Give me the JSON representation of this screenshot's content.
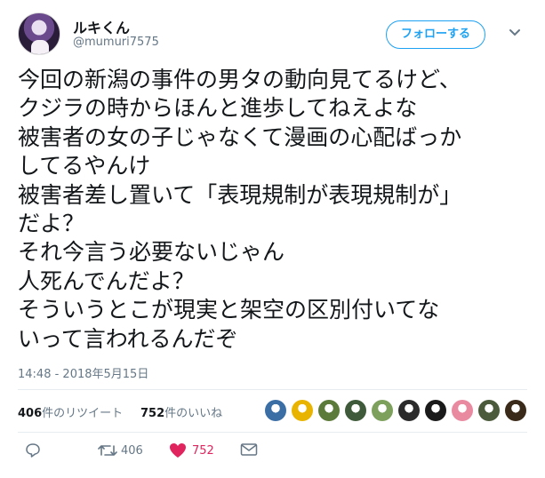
{
  "user": {
    "name": "ルキくん",
    "handle": "@mumuri7575"
  },
  "follow_button": {
    "label": "フォローする"
  },
  "tweet": {
    "lines": [
      "今回の新潟の事件の男タの動向見てるけど、",
      "クジラの時からほんと進歩してねえよな",
      "被害者の女の子じゃなくて漫画の心配ばっか",
      "してるやんけ",
      "被害者差し置いて「表現規制が表現規制が」",
      "だよ？",
      "それ今言う必要ないじゃん",
      "人死んでんだよ？",
      "そういうとこが現実と架空の区別付いてな",
      "いって言われるんだぞ"
    ],
    "timestamp": "14:48 - 2018年5月15日"
  },
  "stats": {
    "retweets_count": "406",
    "retweets_label": "件のリツイート",
    "likes_count": "752",
    "likes_label": "件のいいね"
  },
  "likers": [
    {
      "icon": "liker-avatar-1",
      "color": "#3b6ea5"
    },
    {
      "icon": "liker-avatar-2",
      "color": "#e8b400"
    },
    {
      "icon": "liker-avatar-3",
      "color": "#5c7a3a"
    },
    {
      "icon": "liker-avatar-4",
      "color": "#3f5a3a"
    },
    {
      "icon": "liker-avatar-5",
      "color": "#7da05c"
    },
    {
      "icon": "liker-avatar-6",
      "color": "#2b2b2b"
    },
    {
      "icon": "liker-avatar-7",
      "color": "#1a1a1a"
    },
    {
      "icon": "liker-avatar-8",
      "color": "#e98aa0"
    },
    {
      "icon": "liker-avatar-9",
      "color": "#4a5a3a"
    },
    {
      "icon": "liker-avatar-10",
      "color": "#3a2a1a"
    }
  ],
  "actions": {
    "reply_icon": "reply-icon",
    "retweet_icon": "retweet-icon",
    "retweet_count": "406",
    "like_icon": "heart-icon",
    "like_count": "752",
    "dm_icon": "envelope-icon"
  },
  "colors": {
    "accent": "#1da1f2",
    "like": "#e0245e",
    "muted": "#657786",
    "text": "#14171a"
  }
}
